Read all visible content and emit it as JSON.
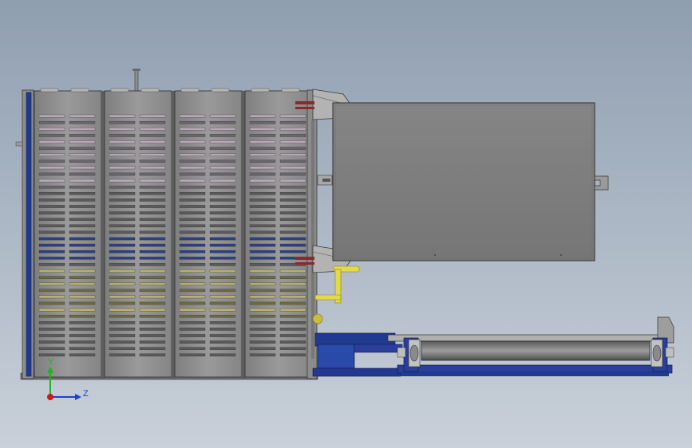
{
  "viewport": {
    "background_top": "#8f9eb0",
    "background_bottom": "#c9d0d9"
  },
  "model": {
    "panel_count": 4,
    "panel_color": "#8a8a8a",
    "frame_accent_color": "#1f3a8f",
    "door_color": "#7d7d7d",
    "handle_color": "#e4d94a",
    "clamp_color": "#8b2a2a",
    "conveyor_frame_color": "#2a3f9a"
  },
  "triad": {
    "y_label": "Y",
    "z_label": "Z",
    "y_color": "#20b020",
    "z_color": "#1f3fd0",
    "x_color": "#d01818"
  }
}
